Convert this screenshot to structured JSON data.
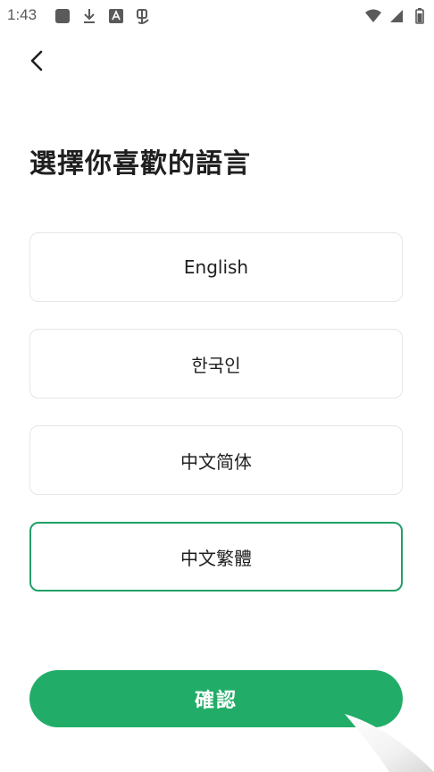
{
  "status_bar": {
    "time": "1:43",
    "icons_left": [
      "square-icon",
      "download-icon",
      "a-box-icon",
      "bug-icon"
    ],
    "icons_right": [
      "wifi-icon",
      "signal-icon",
      "battery-icon"
    ]
  },
  "header": {
    "back_icon": "chevron-left-icon"
  },
  "title": "選擇你喜歡的語言",
  "languages": [
    {
      "label": "English",
      "selected": false
    },
    {
      "label": "한국인",
      "selected": false
    },
    {
      "label": "中文简体",
      "selected": false
    },
    {
      "label": "中文繁體",
      "selected": true
    }
  ],
  "confirm_label": "確認",
  "colors": {
    "accent": "#21ad68",
    "selected_border": "#21a067"
  }
}
